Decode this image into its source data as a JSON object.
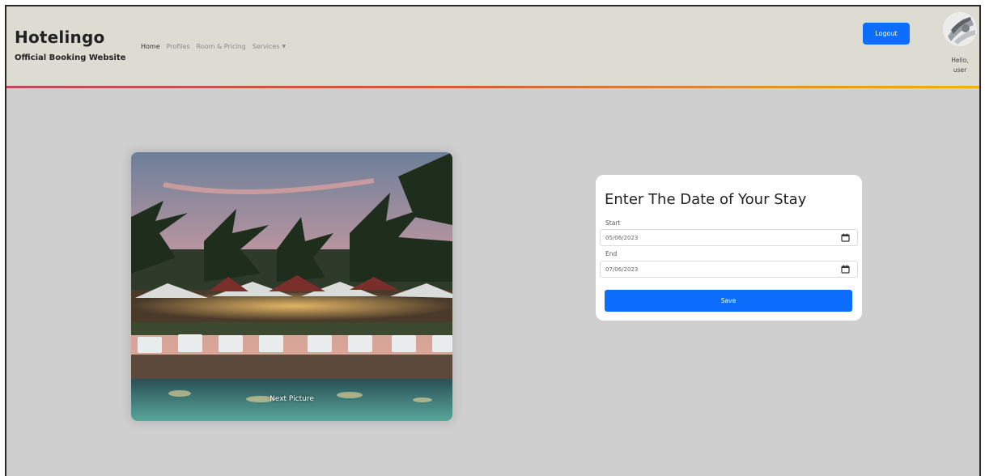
{
  "header": {
    "brand": "Hotelingo",
    "tagline": "Official Booking Website",
    "nav": [
      "Home",
      "Profiles",
      "Room & Pricing",
      "Services"
    ],
    "logout_label": "Logout",
    "greeting_line1": "Hello,",
    "greeting_line2": "user",
    "accent_gradient": [
      "#c0485b",
      "#f0b400"
    ]
  },
  "gallery": {
    "caption": "Next Picture"
  },
  "stay_form": {
    "title": "Enter The Date of Your Stay",
    "start_label": "Start",
    "start_value": "05/06/2023",
    "end_label": "End",
    "end_value": "07/06/2023",
    "save_label": "Save",
    "button_color": "#0d6efd"
  }
}
